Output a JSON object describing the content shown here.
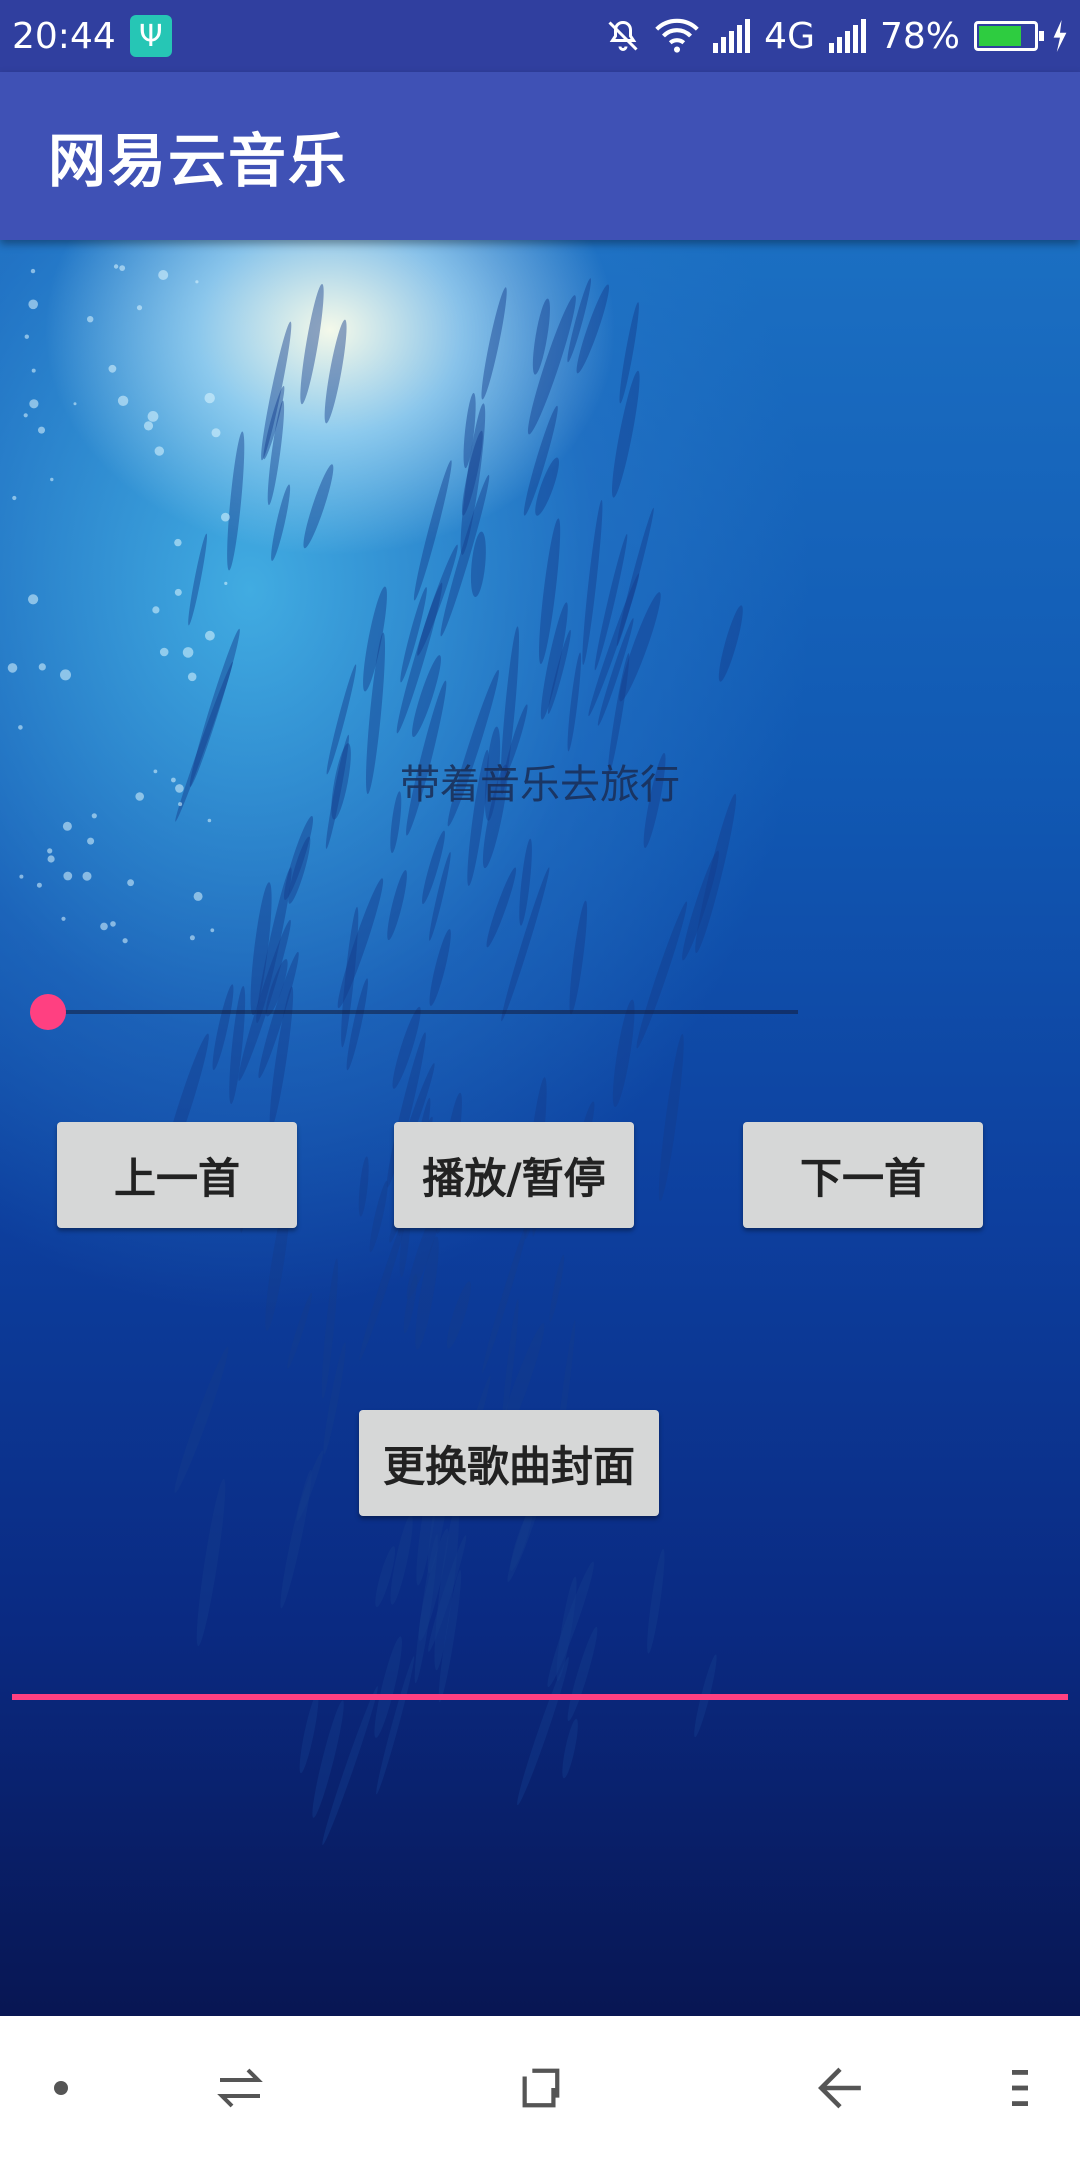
{
  "status_bar": {
    "time": "20:44",
    "usb_icon": "usb-icon",
    "network": "4G",
    "battery_percent": "78%",
    "battery_level": 0.78
  },
  "app_bar": {
    "title": "网易云音乐"
  },
  "content": {
    "caption": "带着音乐去旅行",
    "seek_progress": 0.0,
    "buttons": {
      "previous": "上一首",
      "play_pause": "播放/暂停",
      "next": "下一首",
      "change_cover": "更换歌曲封面"
    },
    "colors": {
      "accent": "#ff4081",
      "primary": "#3f51b5",
      "primary_dark": "#303f9f"
    }
  },
  "nav_bar": {
    "icons": [
      "dot-icon",
      "switch-apps-icon",
      "home-icon",
      "back-icon",
      "menu-icon"
    ]
  }
}
